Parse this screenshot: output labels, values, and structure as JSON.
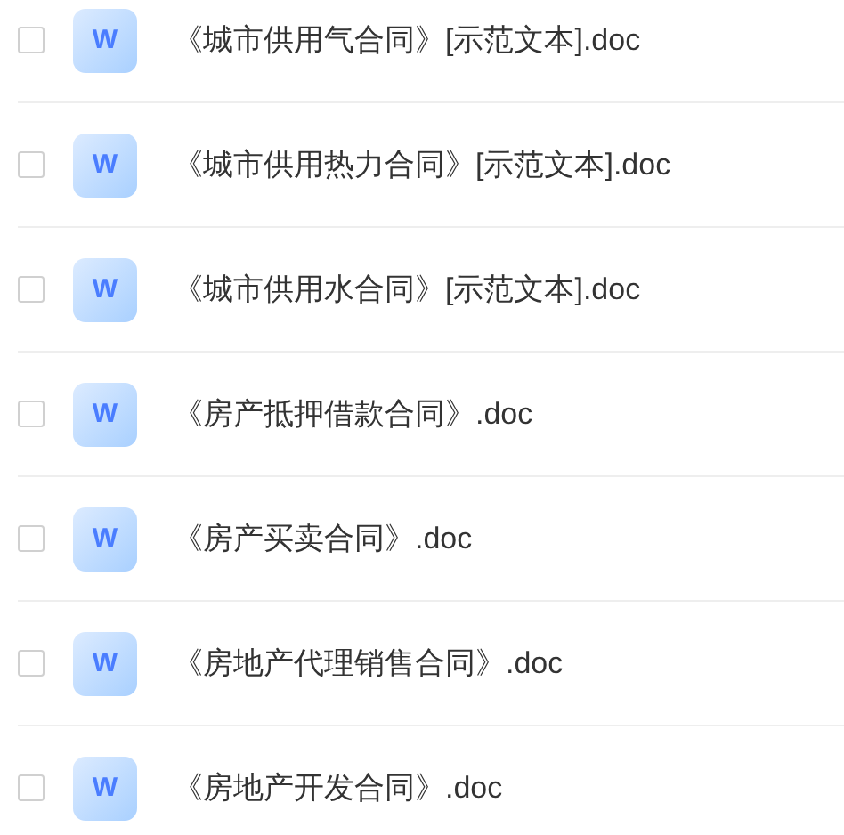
{
  "files": [
    {
      "name": "《城市供用气合同》[示范文本].doc",
      "icon_letter": "W",
      "checked": false
    },
    {
      "name": "《城市供用热力合同》[示范文本].doc",
      "icon_letter": "W",
      "checked": false
    },
    {
      "name": "《城市供用水合同》[示范文本].doc",
      "icon_letter": "W",
      "checked": false
    },
    {
      "name": "《房产抵押借款合同》.doc",
      "icon_letter": "W",
      "checked": false
    },
    {
      "name": "《房产买卖合同》.doc",
      "icon_letter": "W",
      "checked": false
    },
    {
      "name": "《房地产代理销售合同》.doc",
      "icon_letter": "W",
      "checked": false
    },
    {
      "name": "《房地产开发合同》.doc",
      "icon_letter": "W",
      "checked": false
    }
  ]
}
